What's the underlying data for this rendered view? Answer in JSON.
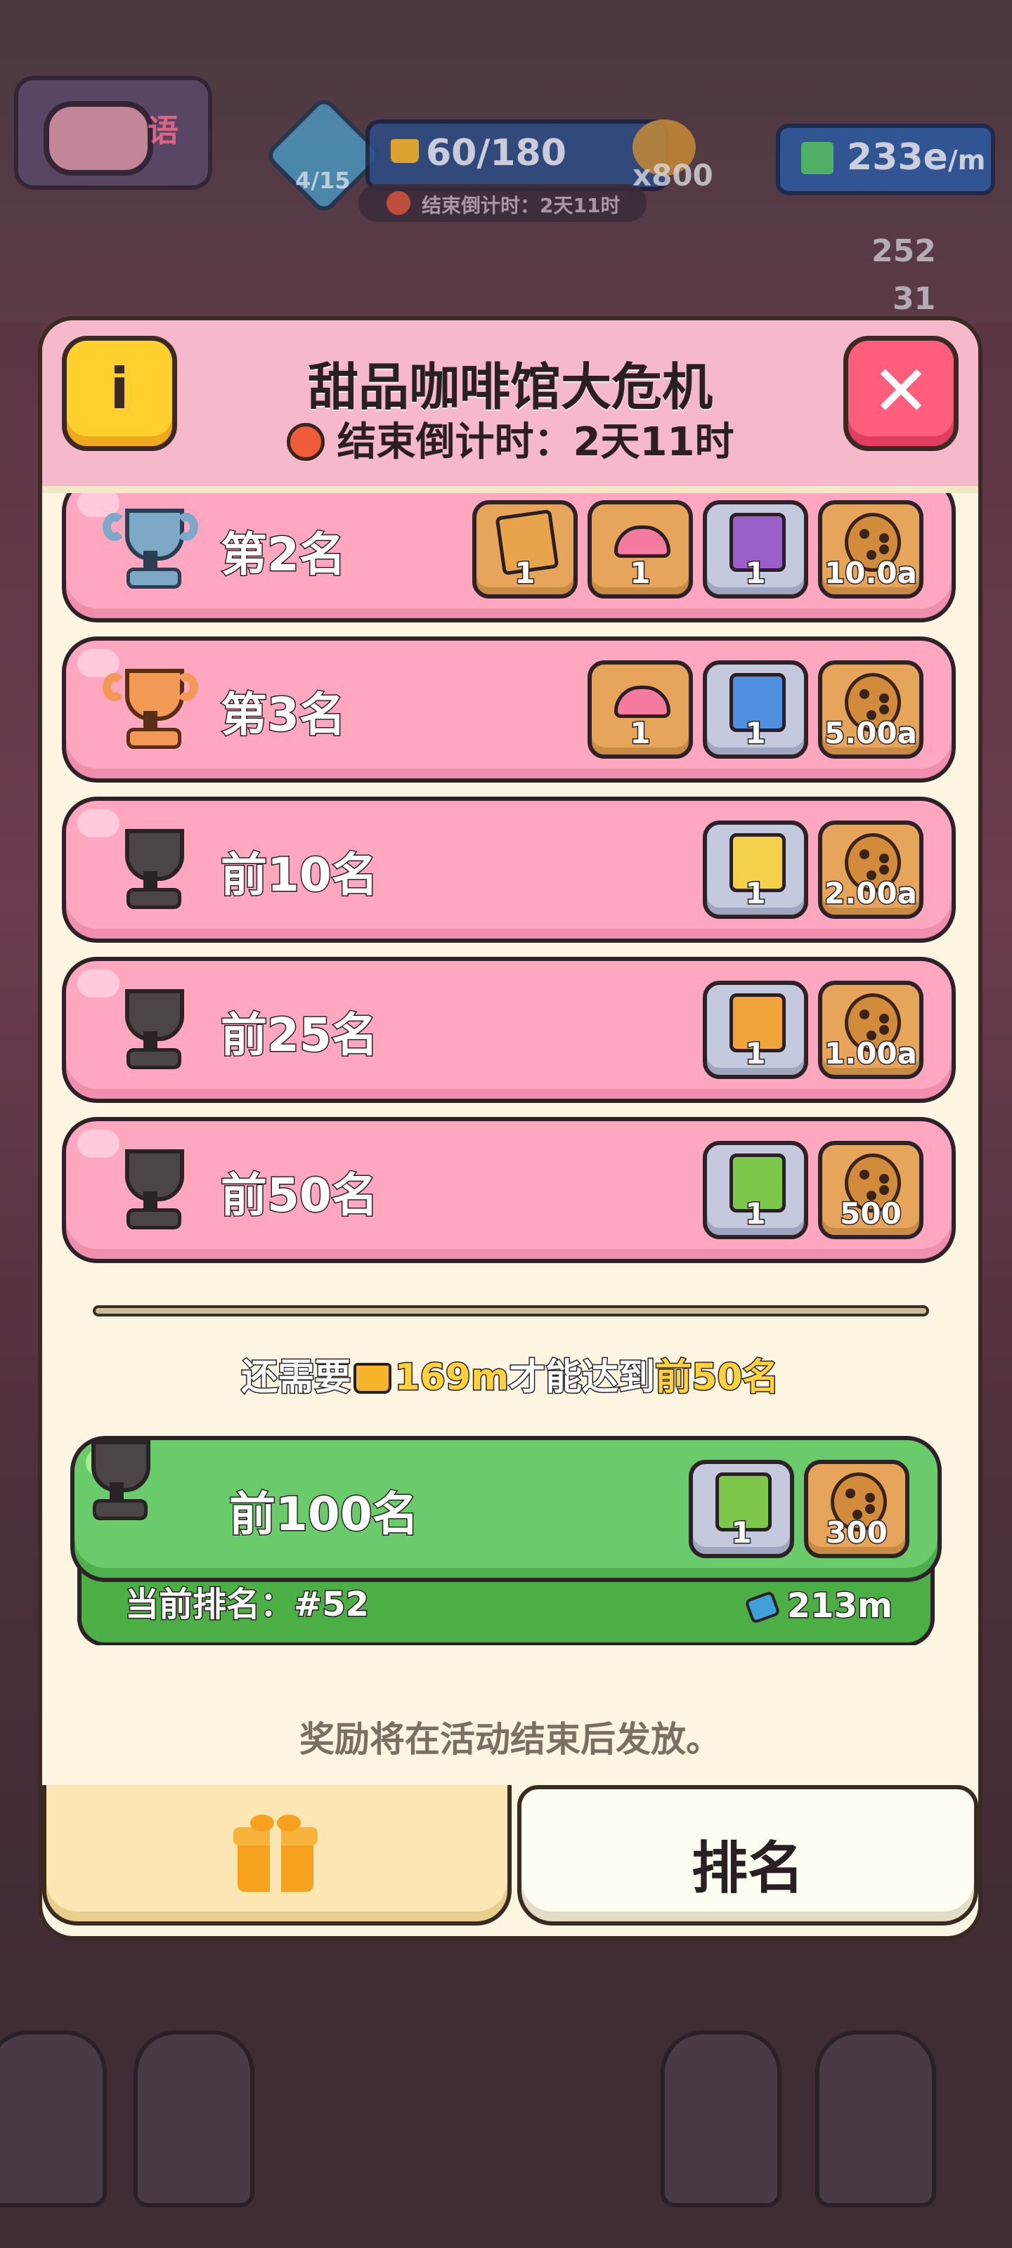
{
  "hud": {
    "menu_tag": "语",
    "trophy_progress": "4/15",
    "crown_progress": "60/180",
    "countdown": "结束倒计时：2天11时",
    "cookie_count": "x800",
    "rate": "233e",
    "rate_unit": "/m",
    "resource_1": "252",
    "resource_2": "31"
  },
  "panel": {
    "title": "甜品咖啡馆大危机",
    "countdown": "结束倒计时：2天11时",
    "info_label": "i",
    "close_label": "✕"
  },
  "rewards_list": [
    {
      "label": "第2名",
      "trophy": "silver",
      "rewards": [
        {
          "type": "box",
          "frame": "gold",
          "qty": "1"
        },
        {
          "type": "hat",
          "frame": "gold",
          "qty": "1"
        },
        {
          "type": "packet-purple",
          "frame": "silver",
          "qty": "1"
        },
        {
          "type": "cookie",
          "frame": "gold",
          "qty": "10.0a"
        }
      ]
    },
    {
      "label": "第3名",
      "trophy": "bronze",
      "rewards": [
        {
          "type": "hat",
          "frame": "gold",
          "qty": "1"
        },
        {
          "type": "packet-blue",
          "frame": "silver",
          "qty": "1"
        },
        {
          "type": "cookie",
          "frame": "gold",
          "qty": "5.00a"
        }
      ]
    },
    {
      "label": "前10名",
      "trophy": "dark",
      "rewards": [
        {
          "type": "packet-yellow",
          "frame": "silver",
          "qty": "1"
        },
        {
          "type": "cookie",
          "frame": "gold",
          "qty": "2.00a"
        }
      ]
    },
    {
      "label": "前25名",
      "trophy": "dark",
      "rewards": [
        {
          "type": "packet-pineapple",
          "frame": "silver",
          "qty": "1"
        },
        {
          "type": "cookie",
          "frame": "gold",
          "qty": "1.00a"
        }
      ]
    },
    {
      "label": "前50名",
      "trophy": "dark",
      "rewards": [
        {
          "type": "packet-green",
          "frame": "silver",
          "qty": "1"
        },
        {
          "type": "cookie",
          "frame": "gold",
          "qty": "500"
        }
      ]
    }
  ],
  "need": {
    "prefix": "还需要",
    "amount": "169m",
    "middle": "才能达到",
    "target": "前50名"
  },
  "current": {
    "label": "前100名",
    "rewards": [
      {
        "type": "packet-green",
        "frame": "silver",
        "qty": "1"
      },
      {
        "type": "cookie",
        "frame": "gold",
        "qty": "300"
      }
    ],
    "rank_text": "当前排名：#52",
    "score": "213m"
  },
  "footer_note": "奖励将在活动结束后发放。",
  "tabs": {
    "gift_icon": "gift-icon",
    "rank_label": "排名"
  },
  "colors": {
    "row_pink": "#ffa7c0",
    "row_green": "#6acb6a",
    "panel": "#fbf5e2",
    "highlight": "#ffd23a"
  }
}
